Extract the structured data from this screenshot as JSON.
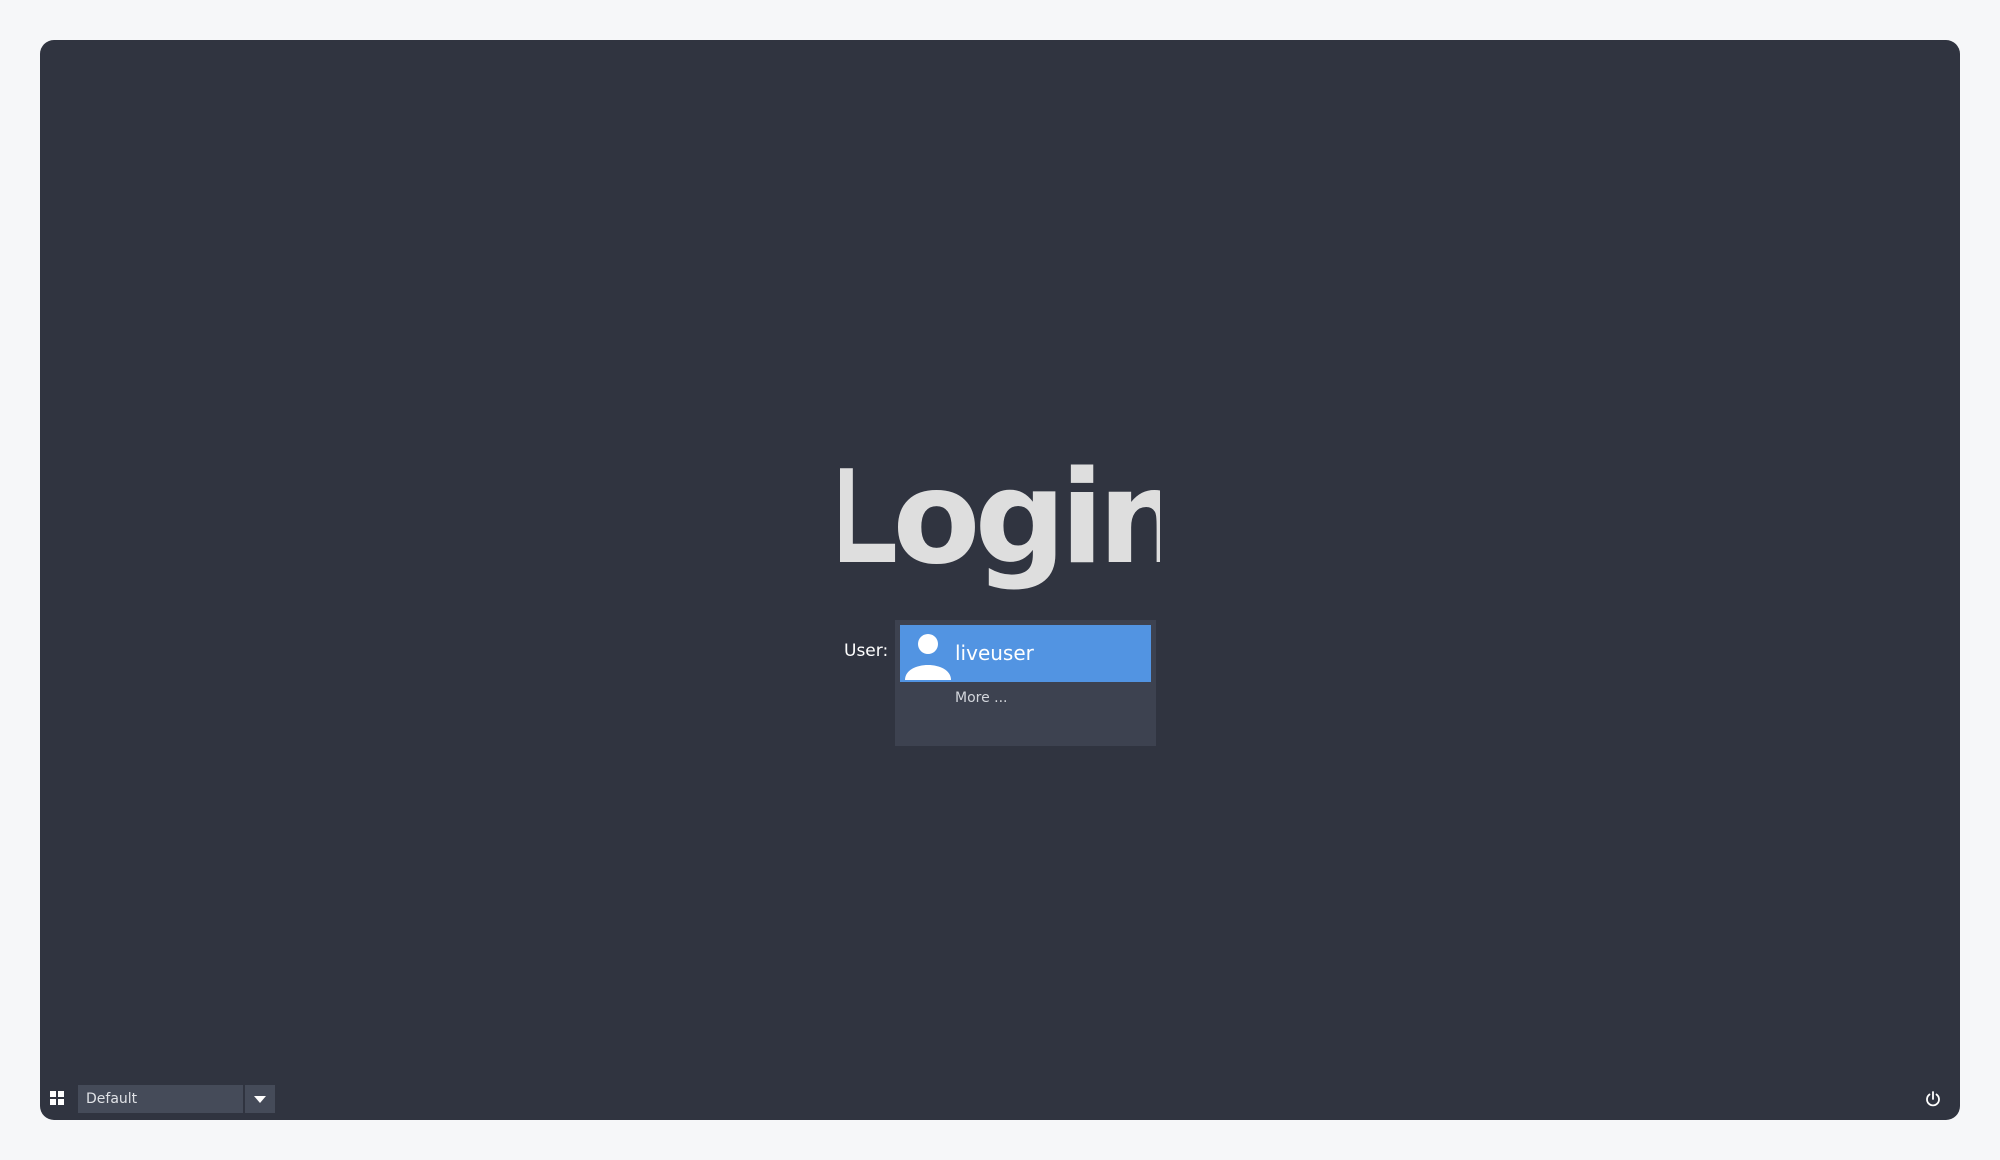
{
  "logo": {
    "text": "Login"
  },
  "login": {
    "user_label": "User:",
    "selected_user": "liveuser",
    "more_label": "More ..."
  },
  "session": {
    "value": "Default"
  },
  "icons": {
    "avatar": "user-avatar-icon",
    "session": "session-grid-icon",
    "dropdown": "chevron-down-icon",
    "power": "power-icon"
  },
  "colors": {
    "background": "#303440",
    "accent": "#5294e2",
    "panel": "#3d4250",
    "logo": "#dedede"
  }
}
